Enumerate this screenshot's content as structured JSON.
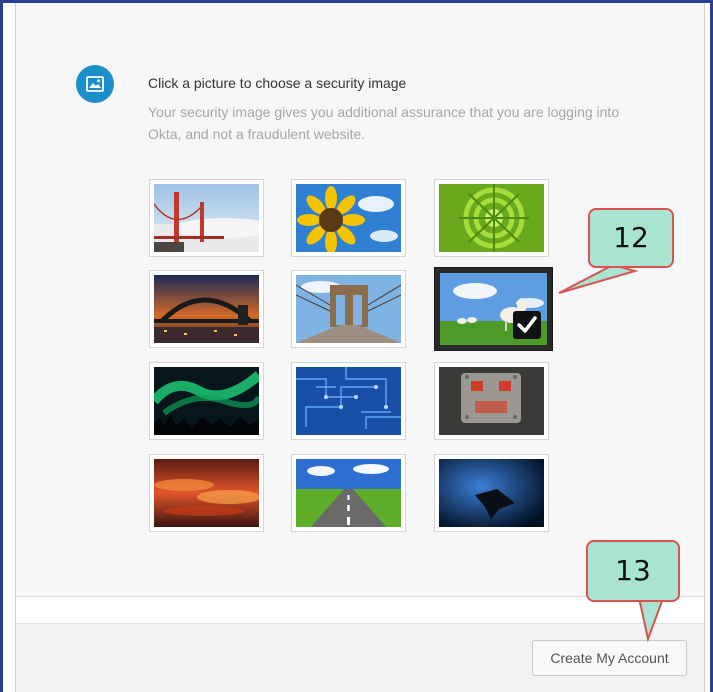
{
  "header": {
    "title": "Click a picture to choose a security image",
    "subtitle": "Your security image gives you additional assurance that you are logging into Okta, and not a fraudulent website."
  },
  "images": [
    {
      "name": "golden-gate-bridge-image",
      "selected": false
    },
    {
      "name": "sunflower-image",
      "selected": false
    },
    {
      "name": "succulent-plant-image",
      "selected": false
    },
    {
      "name": "harbour-bridge-image",
      "selected": false
    },
    {
      "name": "brooklyn-bridge-image",
      "selected": false
    },
    {
      "name": "sheep-field-image",
      "selected": true
    },
    {
      "name": "northern-lights-image",
      "selected": false
    },
    {
      "name": "circuit-board-image",
      "selected": false
    },
    {
      "name": "toy-robot-image",
      "selected": false
    },
    {
      "name": "sunset-clouds-image",
      "selected": false
    },
    {
      "name": "open-road-image",
      "selected": false
    },
    {
      "name": "manta-ray-image",
      "selected": false
    }
  ],
  "annotations": {
    "callout_selected_image": "12",
    "callout_create_button": "13"
  },
  "footer": {
    "create_button_label": "Create My Account"
  },
  "colors": {
    "icon_circle": "#1b8fc9",
    "callout_fill": "#a9e4d2",
    "callout_border": "#d9534f",
    "frame_border": "#2a3f8f"
  }
}
